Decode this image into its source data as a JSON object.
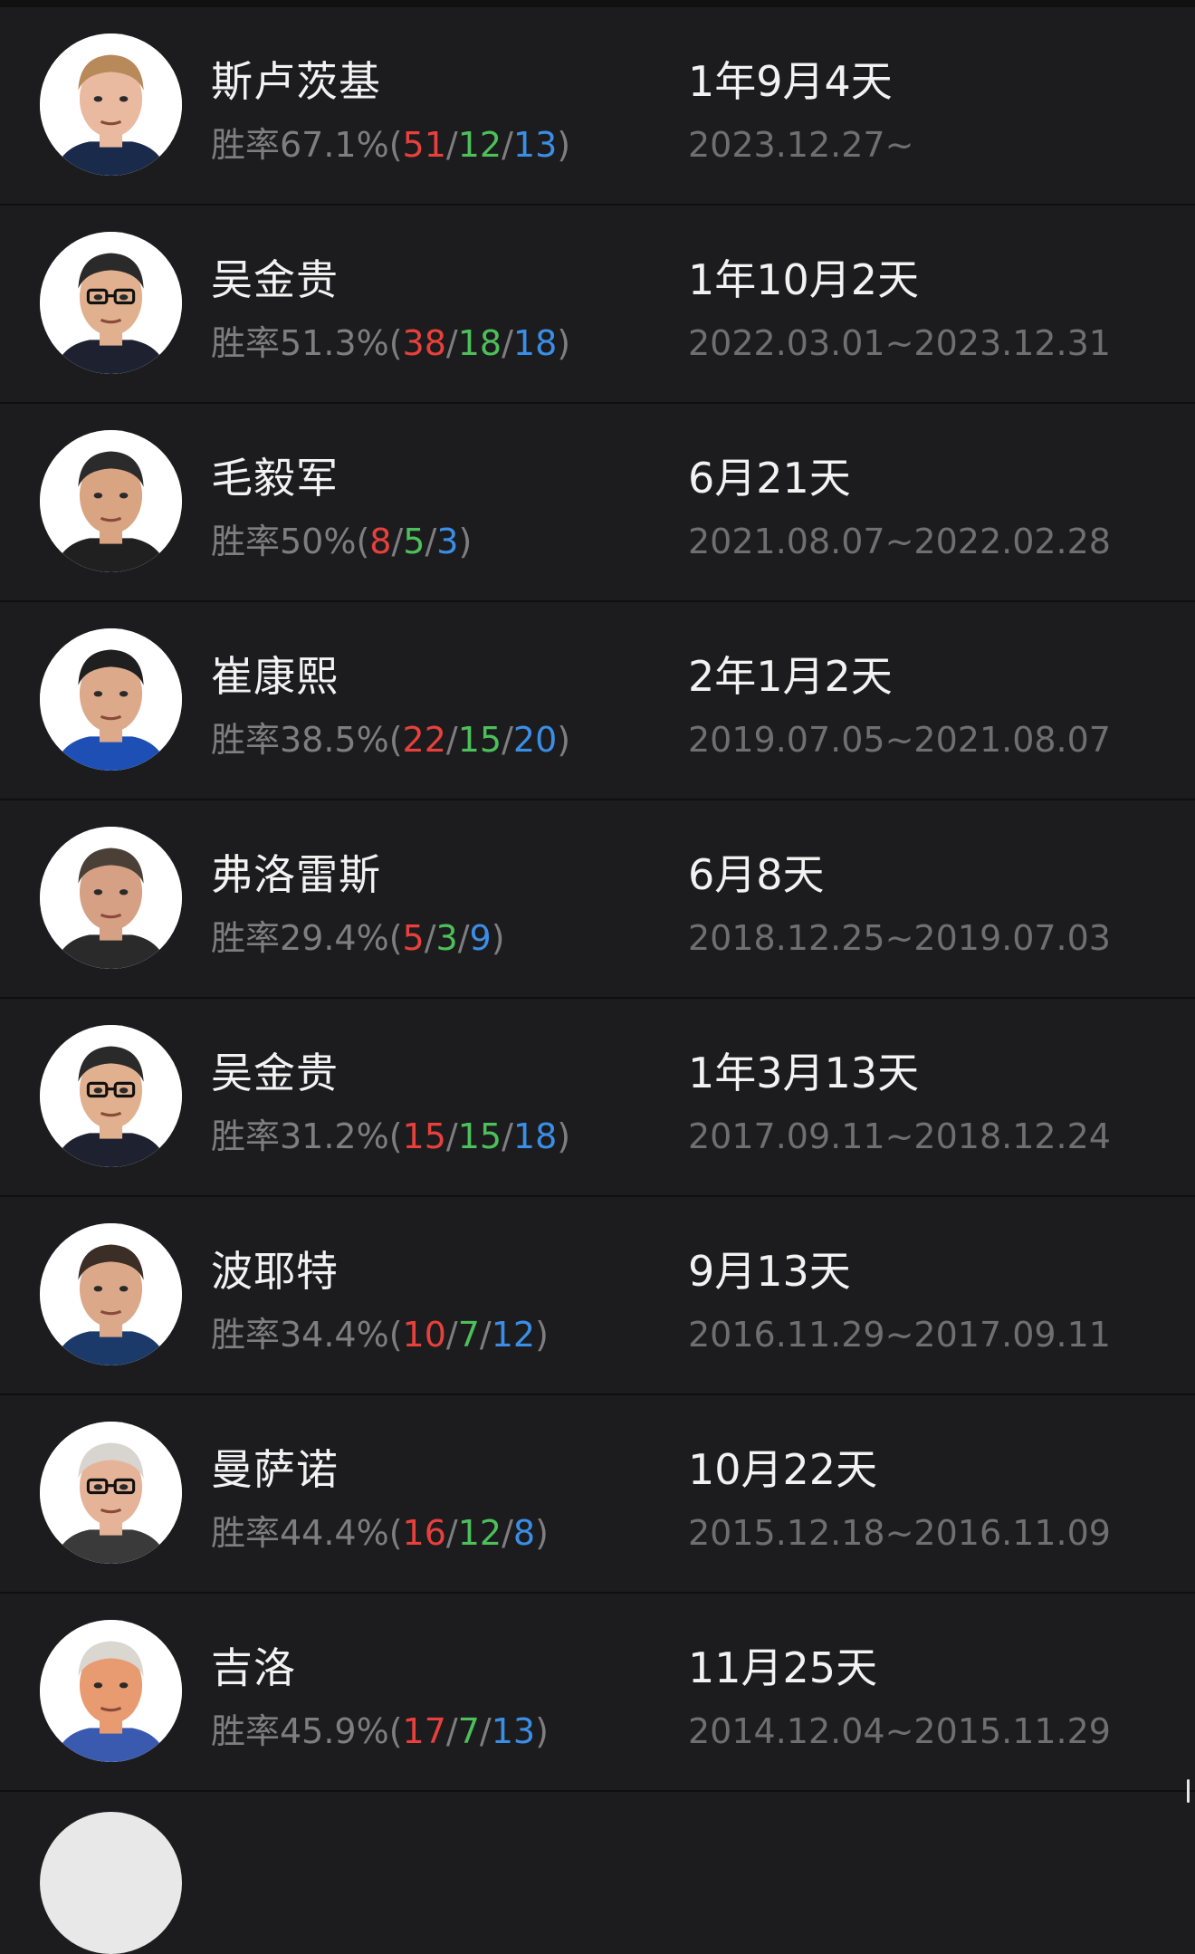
{
  "coaches": [
    {
      "name": "斯卢茨基",
      "rate": "胜率67.1%",
      "w": "51",
      "d": "12",
      "l": "13",
      "duration": "1年9月4天",
      "period": "2023.12.27~",
      "skin": "#e9b9a0",
      "hair": "#b88a5a",
      "shirt": "#1a2a4a"
    },
    {
      "name": "吴金贵",
      "rate": "胜率51.3%",
      "w": "38",
      "d": "18",
      "l": "18",
      "duration": "1年10月2天",
      "period": "2022.03.01~2023.12.31",
      "skin": "#e1b08e",
      "hair": "#2a2a2a",
      "shirt": "#1e2230"
    },
    {
      "name": "毛毅军",
      "rate": "胜率50%",
      "w": "8",
      "d": "5",
      "l": "3",
      "duration": "6月21天",
      "period": "2021.08.07~2022.02.28",
      "skin": "#d9a482",
      "hair": "#2b2b2b",
      "shirt": "#202020"
    },
    {
      "name": "崔康熙",
      "rate": "胜率38.5%",
      "w": "22",
      "d": "15",
      "l": "20",
      "duration": "2年1月2天",
      "period": "2019.07.05~2021.08.07",
      "skin": "#dcaa8a",
      "hair": "#1f1f1f",
      "shirt": "#1e4fb4"
    },
    {
      "name": "弗洛雷斯",
      "rate": "胜率29.4%",
      "w": "5",
      "d": "3",
      "l": "9",
      "duration": "6月8天",
      "period": "2018.12.25~2019.07.03",
      "skin": "#d5a083",
      "hair": "#4a4038",
      "shirt": "#2a2a2a"
    },
    {
      "name": "吴金贵",
      "rate": "胜率31.2%",
      "w": "15",
      "d": "15",
      "l": "18",
      "duration": "1年3月13天",
      "period": "2017.09.11~2018.12.24",
      "skin": "#e1b08e",
      "hair": "#2a2a2a",
      "shirt": "#1e2230"
    },
    {
      "name": "波耶特",
      "rate": "胜率34.4%",
      "w": "10",
      "d": "7",
      "l": "12",
      "duration": "9月13天",
      "period": "2016.11.29~2017.09.11",
      "skin": "#dba88a",
      "hair": "#3a2e26",
      "shirt": "#1b3a6a"
    },
    {
      "name": "曼萨诺",
      "rate": "胜率44.4%",
      "w": "16",
      "d": "12",
      "l": "8",
      "duration": "10月22天",
      "period": "2015.12.18~2016.11.09",
      "skin": "#e5b498",
      "hair": "#d8d4cf",
      "shirt": "#3a3a3a"
    },
    {
      "name": "吉洛",
      "rate": "胜率45.9%",
      "w": "17",
      "d": "7",
      "l": "13",
      "duration": "11月25天",
      "period": "2014.12.04~2015.11.29",
      "skin": "#e89a70",
      "hair": "#dad6d0",
      "shirt": "#3a5ab0"
    }
  ]
}
